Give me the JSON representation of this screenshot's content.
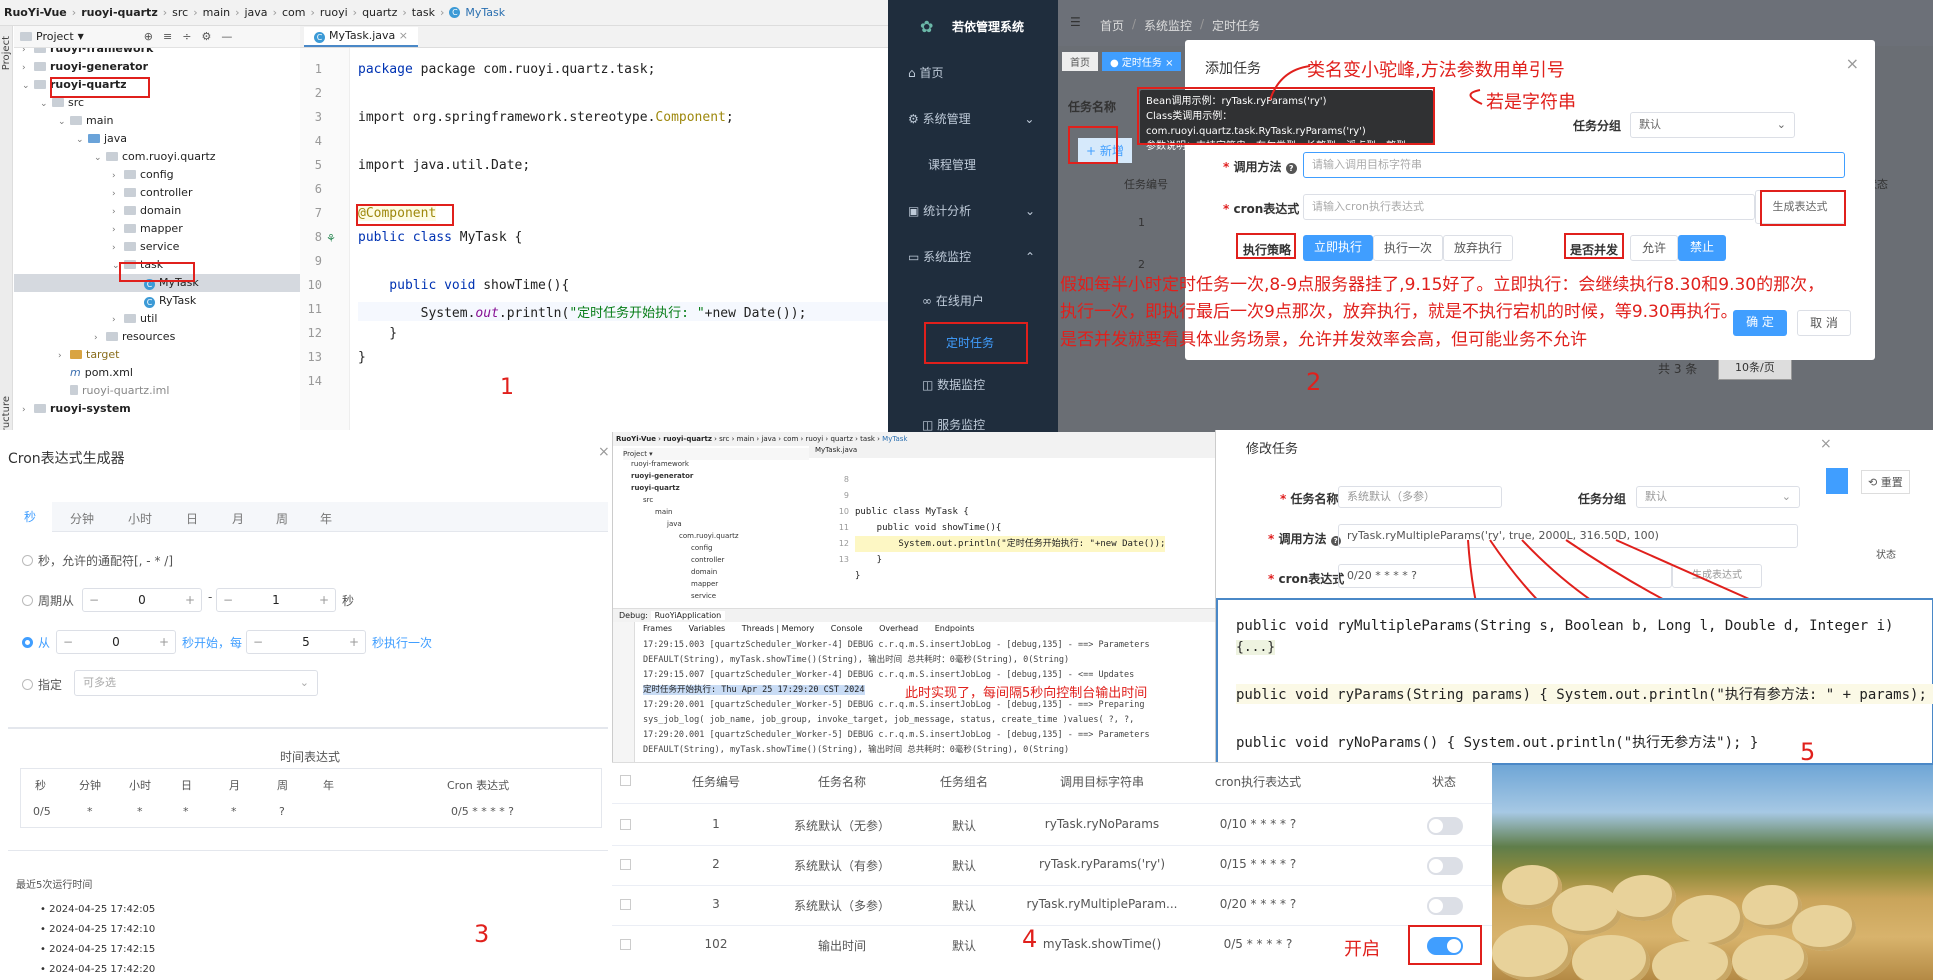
{
  "ide": {
    "breadcrumbs": [
      "RuoYi-Vue",
      "ruoyi-quartz",
      "src",
      "main",
      "java",
      "com",
      "ruoyi",
      "quartz",
      "task",
      "MyTask"
    ],
    "project_label": "Project",
    "tree": [
      {
        "label": "ruoyi-framework"
      },
      {
        "label": "ruoyi-generator"
      },
      {
        "label": "ruoyi-quartz"
      },
      {
        "label": "src"
      },
      {
        "label": "main"
      },
      {
        "label": "java"
      },
      {
        "label": "com.ruoyi.quartz"
      },
      {
        "label": "config"
      },
      {
        "label": "controller"
      },
      {
        "label": "domain"
      },
      {
        "label": "mapper"
      },
      {
        "label": "service"
      },
      {
        "label": "task"
      },
      {
        "label": "MyTask"
      },
      {
        "label": "RyTask"
      },
      {
        "label": "util"
      },
      {
        "label": "resources"
      },
      {
        "label": "target"
      },
      {
        "label": "pom.xml"
      },
      {
        "label": "ruoyi-quartz.iml"
      },
      {
        "label": "ruoyi-system"
      }
    ],
    "tab": "MyTask.java",
    "line_numbers": [
      "1",
      "2",
      "3",
      "4",
      "5",
      "6",
      "7",
      "8",
      "9",
      "10",
      "11",
      "12",
      "13",
      "14"
    ],
    "code": {
      "l1": "package com.ruoyi.quartz.task;",
      "l3a": "import org.springframework.stereotype.",
      "l3b": "Component",
      "l3c": ";",
      "l5": "import java.util.Date;",
      "l7": "@Component",
      "l8a": "public class ",
      "l8b": "MyTask {",
      "l10a": "    public void ",
      "l10b": "showTime(){",
      "l11a": "        System.",
      "l11b": "out",
      "l11c": ".println(",
      "l11d": "\"定时任务开始执行: \"",
      "l11e": "+new Date());",
      "l12": "    }",
      "l13": "}"
    },
    "structure_label": "Structure",
    "panel_number": "1"
  },
  "admin": {
    "system_name": "若依管理系统",
    "breadcrumb": [
      "首页",
      "系统监控",
      "定时任务"
    ],
    "tags": [
      "首页",
      "定时任务"
    ],
    "menu": [
      "首页",
      "系统管理",
      "课程管理",
      "统计分析",
      "系统监控",
      "在线用户",
      "定时任务",
      "数据监控",
      "服务监控"
    ],
    "task_name_label": "任务名称",
    "add_label": "+ 新增",
    "task_no_header": "任务编号",
    "row_nums": [
      "1",
      "2"
    ],
    "status_header": "状态",
    "total": "共 3 条",
    "page_size": "10条/页",
    "dialog": {
      "title": "添加任务",
      "close": "×",
      "group_label": "任务分组",
      "group_value": "默认",
      "method_label": "调用方法",
      "method_placeholder": "请输入调用目标字符串",
      "cron_label": "cron表达式",
      "cron_placeholder": "请输入cron执行表达式",
      "gen_btn": "生成表达式",
      "policy_label": "执行策略",
      "policy_options": [
        "立即执行",
        "执行一次",
        "放弃执行"
      ],
      "concurrent_label": "是否并发",
      "concurrent_options": [
        "允许",
        "禁止"
      ],
      "ok": "确 定",
      "cancel": "取 消"
    },
    "tooltip": {
      "bean_example": "Bean调用示例：ryTask.ryParams('ry')",
      "class_example": "Class类调用示例：com.ruoyi.quartz.task.RyTask.ryParams('ry')",
      "param_desc": "参数说明：支持字符串，布尔类型，长整型，浮点型，整型"
    },
    "notes": {
      "camel": "类名变小驼峰,方法参数用单引号",
      "string": "若是字符串",
      "policy_line1": "假如每半小时定时任务一次,8-9点服务器挂了,9.15好了。立即执行：会继续执行8.30和9.30的那次，",
      "policy_line2": "执行一次，即执行最后一次9点那次，放弃执行，就是不执行宕机的时候，等9.30再执行。",
      "concurrent": "是否并发就要看具体业务场景，允许并发效率会高，但可能业务不允许"
    },
    "panel_number": "2"
  },
  "cron": {
    "title": "Cron表达式生成器",
    "close": "×",
    "tabs": [
      "秒",
      "分钟",
      "小时",
      "日",
      "月",
      "周",
      "年"
    ],
    "opt_any": "秒，允许的通配符[, - * /]",
    "opt_period": "周期从",
    "period_from": "0",
    "period_to": "1",
    "period_unit": "秒",
    "opt_from": "从",
    "from_val": "0",
    "from_mid": "秒开始，每",
    "every_val": "5",
    "every_unit": "秒执行一次",
    "opt_specify": "指定",
    "specify_placeholder": "可多选",
    "expr_title": "时间表达式",
    "headers": [
      "秒",
      "分钟",
      "小时",
      "日",
      "月",
      "周",
      "年",
      "Cron 表达式"
    ],
    "values": [
      "0/5",
      "*",
      "*",
      "*",
      "*",
      "?",
      "",
      "0/5 * * * * ?"
    ],
    "recent_title": "最近5次运行时间",
    "recent": [
      "2024-04-25 17:42:05",
      "2024-04-25 17:42:10",
      "2024-04-25 17:42:15",
      "2024-04-25 17:42:20"
    ],
    "panel_number": "3"
  },
  "debug": {
    "breadcrumbs": [
      "RuoYi-Vue",
      "ruoyi-quartz",
      "src",
      "main",
      "java",
      "com",
      "ruoyi",
      "quartz",
      "task",
      "MyTask"
    ],
    "tree": [
      "ruoyi-framework",
      "ruoyi-generator",
      "ruoyi-quartz",
      "src",
      "main",
      "java",
      "com.ruoyi.quartz",
      "config",
      "controller",
      "domain",
      "mapper",
      "service"
    ],
    "tab": "MyTask.java",
    "code": [
      "public class MyTask {",
      "",
      "    public void showTime(){",
      "        System.out.println(\"定时任务开始执行: \"+new Date());",
      "    }",
      "}"
    ],
    "code_lines": [
      "8",
      "9",
      "10",
      "11",
      "12",
      "13"
    ],
    "debug_label": "Debug:",
    "run_config": "RuoYiApplication",
    "debug_tabs": [
      "Frames",
      "Variables",
      "Threads | Memory",
      "Console",
      "Overhead",
      "Endpoints"
    ],
    "console": [
      "17:29:15.003 [quartzScheduler_Worker-4] DEBUG c.r.q.m.S.insertJobLog - [debug,135] - ==>  Parameters",
      "  DEFAULT(String), myTask.showTime()(String), 输出时间 总共耗时：0毫秒(String), 0(String)",
      "17:29:15.007 [quartzScheduler_Worker-4] DEBUG c.r.q.m.S.insertJobLog - [debug,135] - <==    Updates",
      "定时任务开始执行: Thu Apr 25 17:29:20 CST 2024",
      "17:29:20.001 [quartzScheduler_Worker-5] DEBUG c.r.q.m.S.insertJobLog - [debug,135] - ==>  Preparing",
      "  sys_job_log( job_name, job_group, invoke_target, job_message, status, create_time )values( ?, ?,",
      "17:29:20.001 [quartzScheduler_Worker-5] DEBUG c.r.q.m.S.insertJobLog - [debug,135] - ==>  Parameters",
      "  DEFAULT(String), myTask.showTime()(String), 输出时间 总共耗时：0毫秒(String), 0(String)"
    ],
    "note": "此时实现了，每间隔5秒向控制台输出时间"
  },
  "edit": {
    "title": "修改任务",
    "close": "×",
    "name_label": "任务名称",
    "name_value": "系统默认（多参）",
    "group_label": "任务分组",
    "group_value": "默认",
    "method_label": "调用方法",
    "method_value": "ryTask.ryMultipleParams('ry', true, 2000L, 316.50D, 100)",
    "cron_label": "cron表达式",
    "cron_value": "0/20 * * * * ?",
    "gen_btn": "生成表达式",
    "status_header": "状态",
    "reset": "重置",
    "code": {
      "c1": "public void ryMultipleParams(String s, Boolean b, Long l, Double d, Integer i)",
      "c1b": "{...}",
      "c2": "public void ryParams(String params) { System.out.println(\"执行有参方法: \" + params); }",
      "c3": "public void ryNoParams() { System.out.println(\"执行无参方法\"); }"
    },
    "panel_number": "5"
  },
  "table": {
    "headers": [
      "任务编号",
      "任务名称",
      "任务组名",
      "调用目标字符串",
      "cron执行表达式",
      "状态"
    ],
    "rows": [
      {
        "id": "1",
        "name": "系统默认（无参）",
        "group": "默认",
        "target": "ryTask.ryNoParams",
        "cron": "0/10 * * * * ?",
        "on": false
      },
      {
        "id": "2",
        "name": "系统默认（有参）",
        "group": "默认",
        "target": "ryTask.ryParams('ry')",
        "cron": "0/15 * * * * ?",
        "on": false
      },
      {
        "id": "3",
        "name": "系统默认（多参）",
        "group": "默认",
        "target": "ryTask.ryMultipleParam...",
        "cron": "0/20 * * * * ?",
        "on": false
      },
      {
        "id": "102",
        "name": "输出时间",
        "group": "默认",
        "target": "myTask.showTime()",
        "cron": "0/5 * * * * ?",
        "on": true
      }
    ],
    "panel_number": "4",
    "enabled_note": "开启"
  },
  "colors": {
    "accent": "#409eff",
    "annotation": "#e0201c",
    "sidebar": "#1f2d3d"
  }
}
